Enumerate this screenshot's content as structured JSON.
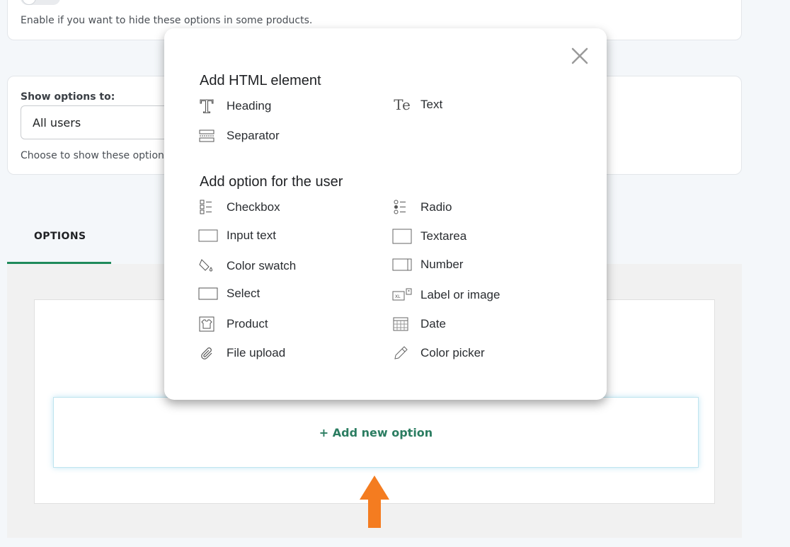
{
  "top_card": {
    "help_text": "Enable if you want to hide these options in some products."
  },
  "show_card": {
    "label": "Show options to:",
    "selected_value": "All users",
    "help_text": "Choose to show these options"
  },
  "tabs": [
    {
      "label": "OPTIONS"
    }
  ],
  "panel": {
    "add_new_label": "+ Add new option"
  },
  "modal": {
    "html_section_title": "Add HTML element",
    "html_items": [
      {
        "label": "Heading",
        "icon": "heading-icon"
      },
      {
        "label": "Text",
        "icon": "text-icon"
      },
      {
        "label": "Separator",
        "icon": "separator-icon"
      }
    ],
    "option_section_title": "Add option for the user",
    "option_items": [
      {
        "label": "Checkbox",
        "icon": "checkbox-icon"
      },
      {
        "label": "Radio",
        "icon": "radio-icon"
      },
      {
        "label": "Input text",
        "icon": "input-text-icon"
      },
      {
        "label": "Textarea",
        "icon": "textarea-icon"
      },
      {
        "label": "Color swatch",
        "icon": "color-swatch-icon"
      },
      {
        "label": "Number",
        "icon": "number-icon"
      },
      {
        "label": "Select",
        "icon": "select-icon"
      },
      {
        "label": "Label or image",
        "icon": "label-image-icon"
      },
      {
        "label": "Product",
        "icon": "product-icon"
      },
      {
        "label": "Date",
        "icon": "date-icon"
      },
      {
        "label": "File upload",
        "icon": "file-upload-icon"
      },
      {
        "label": "Color picker",
        "icon": "color-picker-icon"
      }
    ]
  },
  "colors": {
    "accent_green": "#1f8a5b",
    "highlight_arrow": "#f47c20"
  }
}
